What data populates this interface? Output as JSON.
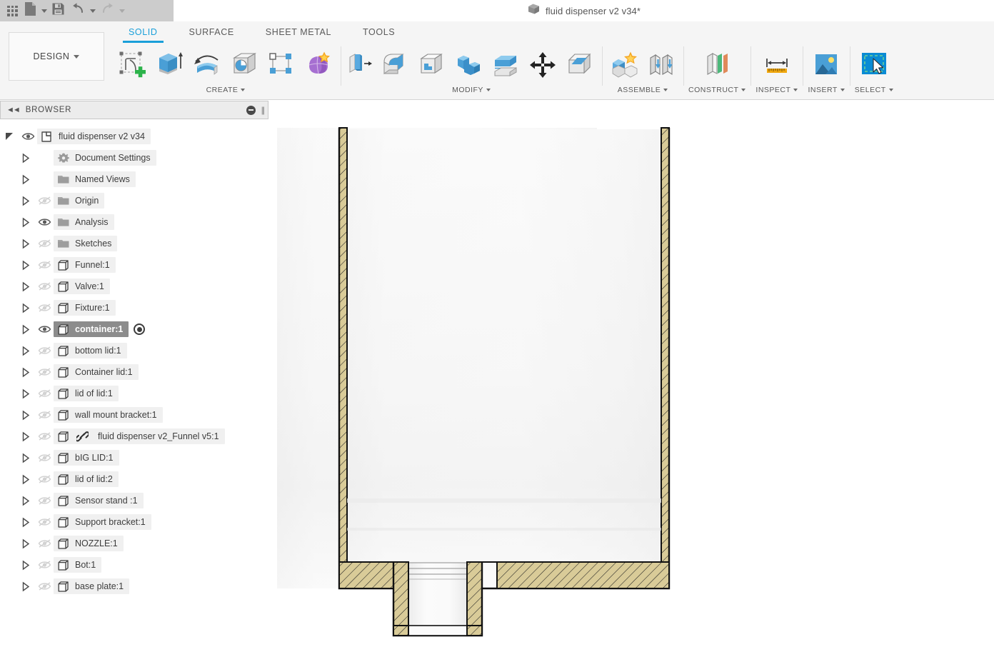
{
  "window": {
    "title": "fluid dispenser v2 v34*",
    "title_icon": "cube-icon"
  },
  "quick_access": {
    "items": [
      {
        "name": "app-grid-button",
        "icon": "grid-icon",
        "label": "",
        "caret": false,
        "dim": false
      },
      {
        "name": "file-menu-button",
        "icon": "file-icon",
        "label": "",
        "caret": true,
        "dim": false
      },
      {
        "name": "save-button",
        "icon": "save-icon",
        "label": "",
        "caret": false,
        "dim": false
      },
      {
        "name": "undo-button",
        "icon": "undo-icon",
        "label": "",
        "caret": true,
        "dim": false
      },
      {
        "name": "redo-button",
        "icon": "redo-icon",
        "label": "",
        "caret": true,
        "dim": true
      }
    ]
  },
  "ribbon": {
    "workspace_selector": {
      "label": "DESIGN",
      "caret": "chevron-down-icon"
    },
    "tabs": [
      {
        "label": "SOLID",
        "active": true
      },
      {
        "label": "SURFACE",
        "active": false
      },
      {
        "label": "SHEET METAL",
        "active": false
      },
      {
        "label": "TOOLS",
        "active": false
      }
    ],
    "accent_color": "#1a9fd9",
    "panels": [
      {
        "label": "CREATE",
        "has_caret": true,
        "tools": [
          {
            "name": "create-sketch-tool",
            "icon": "sketch-plus-icon"
          },
          {
            "name": "extrude-tool",
            "icon": "extrude-icon"
          },
          {
            "name": "revolve-tool",
            "icon": "revolve-icon"
          },
          {
            "name": "hole-tool",
            "icon": "hole-icon"
          },
          {
            "name": "pattern-tool",
            "icon": "pattern-icon"
          },
          {
            "name": "form-tool",
            "icon": "form-sculpt-icon"
          }
        ]
      },
      {
        "label": "MODIFY",
        "has_caret": true,
        "tools": [
          {
            "name": "press-pull-tool",
            "icon": "press-pull-icon"
          },
          {
            "name": "fillet-tool",
            "icon": "fillet-icon"
          },
          {
            "name": "shell-tool",
            "icon": "shell-icon"
          },
          {
            "name": "combine-tool",
            "icon": "combine-icon"
          },
          {
            "name": "offset-face-tool",
            "icon": "offset-face-icon"
          },
          {
            "name": "move-copy-tool",
            "icon": "move-arrows-icon"
          },
          {
            "name": "split-face-tool",
            "icon": "split-face-icon"
          }
        ]
      },
      {
        "label": "ASSEMBLE",
        "has_caret": true,
        "tools": [
          {
            "name": "new-component-tool",
            "icon": "new-component-icon"
          },
          {
            "name": "joint-tool",
            "icon": "joint-icon"
          }
        ]
      },
      {
        "label": "CONSTRUCT",
        "has_caret": true,
        "tools": [
          {
            "name": "offset-plane-tool",
            "icon": "construct-plane-icon"
          }
        ]
      },
      {
        "label": "INSPECT",
        "has_caret": true,
        "tools": [
          {
            "name": "measure-tool",
            "icon": "measure-ruler-icon"
          }
        ]
      },
      {
        "label": "INSERT",
        "has_caret": true,
        "tools": [
          {
            "name": "insert-mcmaster-tool",
            "icon": "insert-image-icon"
          }
        ]
      },
      {
        "label": "SELECT",
        "has_caret": true,
        "tools": [
          {
            "name": "select-tool",
            "icon": "select-cursor-icon"
          }
        ]
      }
    ]
  },
  "browser": {
    "panel_title": "BROWSER",
    "collapse_icon": "double-left-arrow-icon",
    "minimize_icon": "minus-circle-icon",
    "grip_icon": "drag-handle-icon",
    "root": {
      "label": "fluid dispenser v2 v34",
      "icon": "document-component-icon",
      "twisty": "expanded",
      "visibility": "visible"
    },
    "items": [
      {
        "label": "Document Settings",
        "icon": "gear-icon",
        "indent": 1,
        "eye": "none",
        "selected": false,
        "link": false
      },
      {
        "label": "Named Views",
        "icon": "folder-icon",
        "indent": 1,
        "eye": "none",
        "selected": false,
        "link": false
      },
      {
        "label": "Origin",
        "icon": "folder-icon",
        "indent": 1,
        "eye": "hidden",
        "selected": false,
        "link": false
      },
      {
        "label": "Analysis",
        "icon": "folder-icon",
        "indent": 1,
        "eye": "visible",
        "selected": false,
        "link": false
      },
      {
        "label": "Sketches",
        "icon": "folder-icon",
        "indent": 1,
        "eye": "hidden",
        "selected": false,
        "link": false
      },
      {
        "label": "Funnel:1",
        "icon": "component-icon",
        "indent": 1,
        "eye": "hidden",
        "selected": false,
        "link": false
      },
      {
        "label": "Valve:1",
        "icon": "component-icon",
        "indent": 1,
        "eye": "hidden",
        "selected": false,
        "link": false
      },
      {
        "label": "Fixture:1",
        "icon": "component-icon",
        "indent": 1,
        "eye": "hidden",
        "selected": false,
        "link": false
      },
      {
        "label": "container:1",
        "icon": "component-icon",
        "indent": 1,
        "eye": "visible",
        "selected": true,
        "link": false,
        "activated": true
      },
      {
        "label": "bottom lid:1",
        "icon": "component-icon",
        "indent": 1,
        "eye": "hidden",
        "selected": false,
        "link": false
      },
      {
        "label": "Container lid:1",
        "icon": "component-icon",
        "indent": 1,
        "eye": "hidden",
        "selected": false,
        "link": false
      },
      {
        "label": "lid of lid:1",
        "icon": "component-icon",
        "indent": 1,
        "eye": "hidden",
        "selected": false,
        "link": false
      },
      {
        "label": "wall mount bracket:1",
        "icon": "component-icon",
        "indent": 1,
        "eye": "hidden",
        "selected": false,
        "link": false
      },
      {
        "label": "fluid dispenser v2_Funnel v5:1",
        "icon": "component-icon",
        "indent": 1,
        "eye": "hidden",
        "selected": false,
        "link": true
      },
      {
        "label": "bIG LID:1",
        "icon": "component-icon",
        "indent": 1,
        "eye": "hidden",
        "selected": false,
        "link": false
      },
      {
        "label": "lid of lid:2",
        "icon": "component-icon",
        "indent": 1,
        "eye": "hidden",
        "selected": false,
        "link": false
      },
      {
        "label": "Sensor stand :1",
        "icon": "component-icon",
        "indent": 1,
        "eye": "hidden",
        "selected": false,
        "link": false
      },
      {
        "label": "Support bracket:1",
        "icon": "component-icon",
        "indent": 1,
        "eye": "hidden",
        "selected": false,
        "link": false
      },
      {
        "label": "NOZZLE:1",
        "icon": "component-icon",
        "indent": 1,
        "eye": "hidden",
        "selected": false,
        "link": false
      },
      {
        "label": "Bot:1",
        "icon": "component-icon",
        "indent": 1,
        "eye": "hidden",
        "selected": false,
        "link": false
      },
      {
        "label": "base plate:1",
        "icon": "component-icon",
        "indent": 1,
        "eye": "hidden",
        "selected": false,
        "link": false
      }
    ]
  },
  "canvas": {
    "view": "section-analysis-front",
    "model_name": "container",
    "section_hatch_color": "#d9cb98",
    "section_edge_color": "#1a1a1a",
    "body_fill_color": "#f2f2f2",
    "background_color": "#ffffff"
  }
}
